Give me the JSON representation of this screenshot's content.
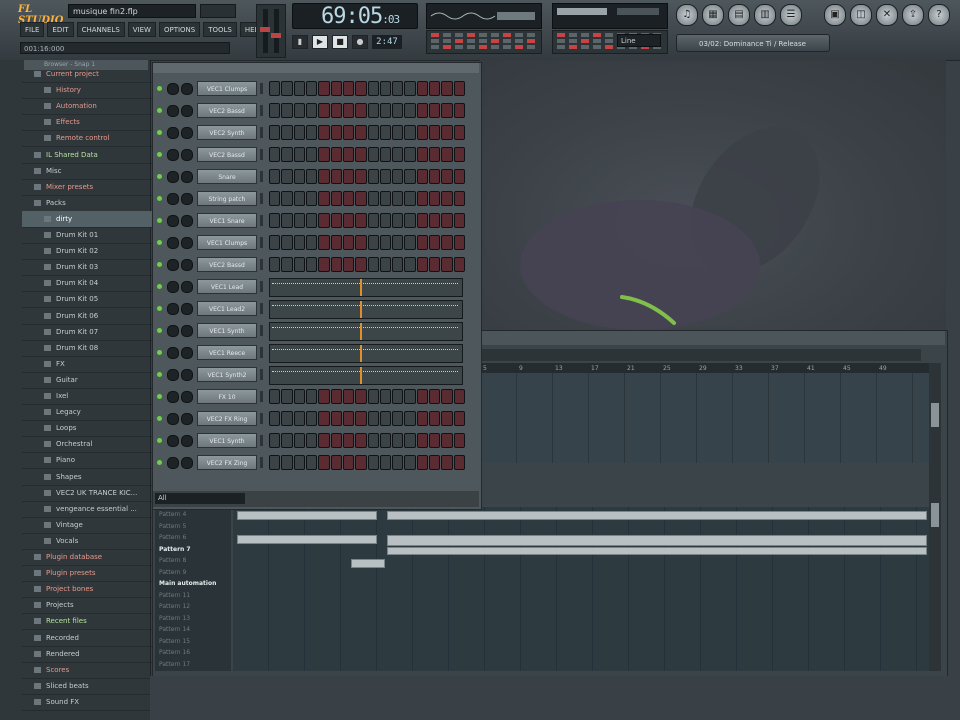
{
  "app": {
    "logo_text": "FL STUDIO",
    "filename": "musique fin2.flp",
    "hint_text": "001:16:000"
  },
  "menu": [
    "FILE",
    "EDIT",
    "CHANNELS",
    "VIEW",
    "OPTIONS",
    "TOOLS",
    "HELP"
  ],
  "transport": {
    "time_main": "69:05",
    "time_sub": ":03",
    "tempo": "2:47",
    "snap": "Line"
  },
  "toolbar": {
    "plugin_name": "03/02: Dominance Ti / Release"
  },
  "browser": {
    "tab_label": "Browser - Snap 1",
    "items": [
      {
        "label": "Current project",
        "style": "red",
        "level": "top"
      },
      {
        "label": "History",
        "style": "red",
        "level": "sub"
      },
      {
        "label": "Automation",
        "style": "red",
        "level": "sub"
      },
      {
        "label": "Effects",
        "style": "red",
        "level": "sub"
      },
      {
        "label": "Remote control",
        "style": "red",
        "level": "sub"
      },
      {
        "label": "IL Shared Data",
        "style": "green",
        "level": "top"
      },
      {
        "label": "Misc",
        "style": "normal",
        "level": "top"
      },
      {
        "label": "Mixer presets",
        "style": "red",
        "level": "top"
      },
      {
        "label": "Packs",
        "style": "normal",
        "level": "top"
      },
      {
        "label": "dirty",
        "style": "sel",
        "level": "sub"
      },
      {
        "label": "Drum Kit 01",
        "style": "normal",
        "level": "sub"
      },
      {
        "label": "Drum Kit 02",
        "style": "normal",
        "level": "sub"
      },
      {
        "label": "Drum Kit 03",
        "style": "normal",
        "level": "sub"
      },
      {
        "label": "Drum Kit 04",
        "style": "normal",
        "level": "sub"
      },
      {
        "label": "Drum Kit 05",
        "style": "normal",
        "level": "sub"
      },
      {
        "label": "Drum Kit 06",
        "style": "normal",
        "level": "sub"
      },
      {
        "label": "Drum Kit 07",
        "style": "normal",
        "level": "sub"
      },
      {
        "label": "Drum Kit 08",
        "style": "normal",
        "level": "sub"
      },
      {
        "label": "FX",
        "style": "normal",
        "level": "sub"
      },
      {
        "label": "Guitar",
        "style": "normal",
        "level": "sub"
      },
      {
        "label": "Ixel",
        "style": "normal",
        "level": "sub"
      },
      {
        "label": "Legacy",
        "style": "normal",
        "level": "sub"
      },
      {
        "label": "Loops",
        "style": "normal",
        "level": "sub"
      },
      {
        "label": "Orchestral",
        "style": "normal",
        "level": "sub"
      },
      {
        "label": "Piano",
        "style": "normal",
        "level": "sub"
      },
      {
        "label": "Shapes",
        "style": "normal",
        "level": "sub"
      },
      {
        "label": "VEC2 UK TRANCE KIC...",
        "style": "normal",
        "level": "sub"
      },
      {
        "label": "vengeance essential ...",
        "style": "normal",
        "level": "sub"
      },
      {
        "label": "Vintage",
        "style": "normal",
        "level": "sub"
      },
      {
        "label": "Vocals",
        "style": "normal",
        "level": "sub"
      },
      {
        "label": "Plugin database",
        "style": "red",
        "level": "top"
      },
      {
        "label": "Plugin presets",
        "style": "red",
        "level": "top"
      },
      {
        "label": "Project bones",
        "style": "red",
        "level": "top"
      },
      {
        "label": "Projects",
        "style": "normal",
        "level": "top"
      },
      {
        "label": "Recent files",
        "style": "green",
        "level": "top"
      },
      {
        "label": "Recorded",
        "style": "normal",
        "level": "top"
      },
      {
        "label": "Rendered",
        "style": "normal",
        "level": "top"
      },
      {
        "label": "Scores",
        "style": "red",
        "level": "top"
      },
      {
        "label": "Sliced beats",
        "style": "normal",
        "level": "top"
      },
      {
        "label": "Sound FX",
        "style": "normal",
        "level": "top"
      }
    ]
  },
  "channel_rack": {
    "filter": "All",
    "channels": [
      {
        "name": "VEC1 Clumps",
        "mode": "steps"
      },
      {
        "name": "VEC2 Bassd",
        "mode": "steps"
      },
      {
        "name": "VEC2 Synth",
        "mode": "steps"
      },
      {
        "name": "VEC2 Bassd",
        "mode": "steps"
      },
      {
        "name": "Snare",
        "mode": "steps"
      },
      {
        "name": "String patch",
        "mode": "steps"
      },
      {
        "name": "VEC1 Snare",
        "mode": "steps"
      },
      {
        "name": "VEC1 Clumps",
        "mode": "steps"
      },
      {
        "name": "VEC2 Bassd",
        "mode": "steps"
      },
      {
        "name": "VEC1 Lead",
        "mode": "roll"
      },
      {
        "name": "VEC1 Lead2",
        "mode": "roll"
      },
      {
        "name": "VEC1 Synth",
        "mode": "roll"
      },
      {
        "name": "VEC1 Reece",
        "mode": "roll"
      },
      {
        "name": "VEC1 Synth2",
        "mode": "roll"
      },
      {
        "name": "FX 10",
        "mode": "steps"
      },
      {
        "name": "VEC2 FX Ring",
        "mode": "steps"
      },
      {
        "name": "VEC1 Synth",
        "mode": "steps"
      },
      {
        "name": "VEC2 FX Zing",
        "mode": "steps"
      }
    ]
  },
  "playlist": {
    "ruler": [
      "5",
      "9",
      "13",
      "17",
      "21",
      "25",
      "29",
      "33",
      "37",
      "41",
      "45",
      "49"
    ],
    "patterns": [
      {
        "label": "Pattern 4",
        "active": false
      },
      {
        "label": "Pattern 5",
        "active": false
      },
      {
        "label": "Pattern 6",
        "active": false
      },
      {
        "label": "Pattern 7",
        "active": true
      },
      {
        "label": "Pattern 8",
        "active": false
      },
      {
        "label": "Pattern 9",
        "active": false
      },
      {
        "label": "Main automation",
        "active": true
      },
      {
        "label": "Pattern 11",
        "active": false
      },
      {
        "label": "Pattern 12",
        "active": false
      },
      {
        "label": "Pattern 13",
        "active": false
      },
      {
        "label": "Pattern 14",
        "active": false
      },
      {
        "label": "Pattern 15",
        "active": false
      },
      {
        "label": "Pattern 16",
        "active": false
      },
      {
        "label": "Pattern 17",
        "active": false
      }
    ]
  },
  "colors": {
    "accent_orange": "#e0902a",
    "led_green": "#6fcf4a",
    "step_red": "#5a2b30"
  }
}
